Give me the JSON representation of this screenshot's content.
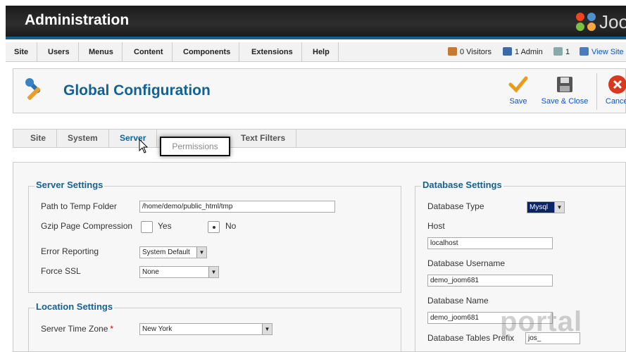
{
  "header": {
    "title": "Administration",
    "logo_text": "Joo"
  },
  "menu": {
    "items": [
      "Site",
      "Users",
      "Menus",
      "Content",
      "Components",
      "Extensions",
      "Help"
    ]
  },
  "status": {
    "visitors": "0 Visitors",
    "admin": "1 Admin",
    "messages": "1",
    "view_site": "View Site"
  },
  "toolbar": {
    "title": "Global Configuration",
    "save": "Save",
    "save_close": "Save & Close",
    "cancel": "Cancel"
  },
  "tabs": {
    "items": [
      "Site",
      "System",
      "Server",
      "Text Filters"
    ],
    "active": "Server",
    "tooltip": "Permissions"
  },
  "server_settings": {
    "legend": "Server Settings",
    "temp_label": "Path to Temp Folder",
    "temp_value": "/home/demo/public_html/tmp",
    "gzip_label": "Gzip Page Compression",
    "gzip_yes": "Yes",
    "gzip_no": "No",
    "error_label": "Error Reporting",
    "error_value": "System Default",
    "ssl_label": "Force SSL",
    "ssl_value": "None"
  },
  "location_settings": {
    "legend": "Location Settings",
    "tz_label": "Server Time Zone",
    "tz_required": "*",
    "tz_value": "New York"
  },
  "database_settings": {
    "legend": "Database Settings",
    "type_label": "Database Type",
    "type_value": "Mysql",
    "host_label": "Host",
    "host_value": "localhost",
    "user_label": "Database Username",
    "user_value": "demo_joom681",
    "name_label": "Database Name",
    "name_value": "demo_joom681",
    "prefix_label": "Database Tables Prefix",
    "prefix_value": "jos_"
  },
  "watermark": "portal",
  "colors": {
    "accent": "#146295",
    "header_bar": "#1a5f86"
  }
}
